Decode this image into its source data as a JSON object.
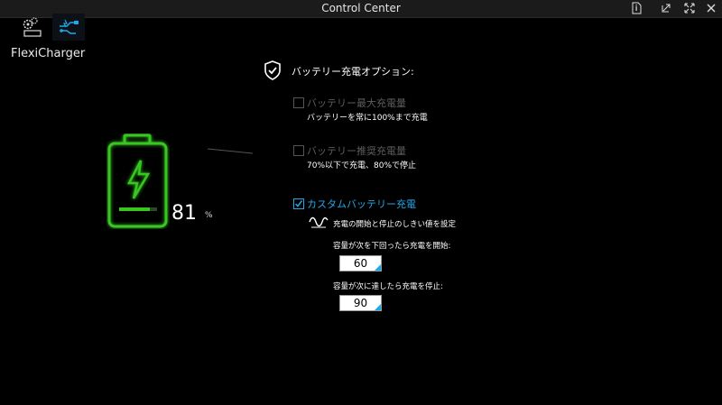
{
  "window": {
    "title": "Control Center"
  },
  "tabs": [
    {
      "icon": "settings-icon",
      "active": false
    },
    {
      "icon": "usb-charger-icon",
      "active": true
    }
  ],
  "section": {
    "name": "FlexiCharger"
  },
  "battery": {
    "level": 81,
    "unit": "%",
    "accent": "#39c620"
  },
  "options": {
    "heading": "バッテリー充電オプション:",
    "max_capacity": {
      "label": "バッテリー最大充電量",
      "desc": "バッテリーを常に100%まで充電",
      "checked": false,
      "enabled": false
    },
    "recommended": {
      "label": "バッテリー推奨充電量",
      "desc": "70%以下で充電、80%で停止",
      "checked": false,
      "enabled": false
    },
    "custom": {
      "label": "カスタムバッテリー充電",
      "checked": true,
      "enabled": true
    }
  },
  "threshold": {
    "title": "充電の開始と停止のしきい値を設定",
    "start_label": "容量が次を下回ったら充電を開始:",
    "start_value": "60",
    "stop_label": "容量が次に達したら充電を停止:",
    "stop_value": "90"
  },
  "colors": {
    "accent_blue": "#1fa8e8",
    "battery_green": "#39c620"
  }
}
